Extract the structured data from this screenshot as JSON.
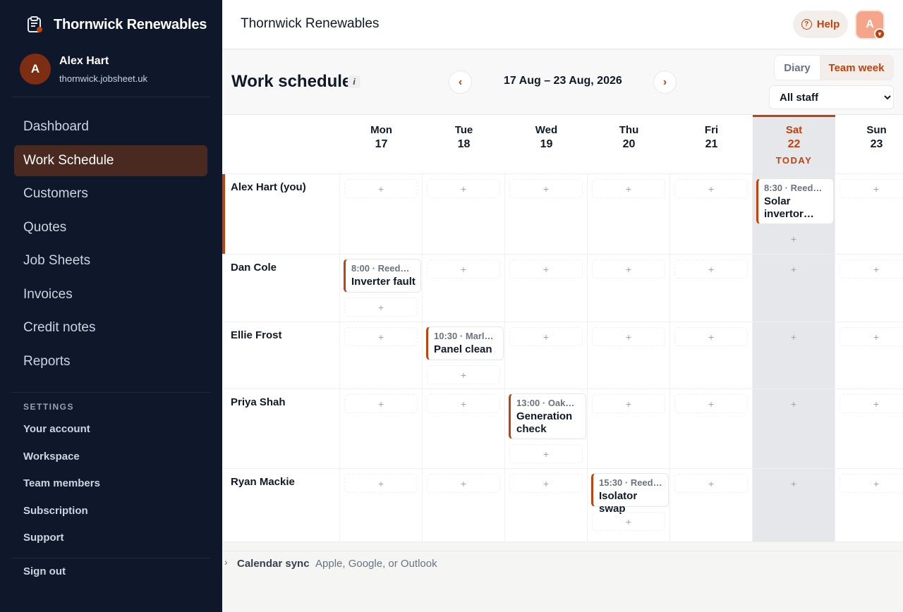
{
  "brand": {
    "name": "Thornwick Renewables",
    "icon": "clipboard-icon"
  },
  "user": {
    "initial": "A",
    "name": "Alex Hart",
    "domain": "thornwick.jobsheet.uk"
  },
  "nav": [
    {
      "label": "Dashboard"
    },
    {
      "label": "Work Schedule",
      "active": true
    },
    {
      "label": "Customers"
    },
    {
      "label": "Quotes"
    },
    {
      "label": "Job Sheets"
    },
    {
      "label": "Invoices"
    },
    {
      "label": "Credit notes"
    },
    {
      "label": "Reports"
    }
  ],
  "settings": {
    "heading": "SETTINGS",
    "items": [
      {
        "label": "Your account"
      },
      {
        "label": "Workspace"
      },
      {
        "label": "Team members"
      },
      {
        "label": "Subscription"
      },
      {
        "label": "Support"
      }
    ],
    "signout": "Sign out"
  },
  "topbar": {
    "title": "Thornwick Renewables",
    "help": "Help",
    "avatar": "A"
  },
  "schedule": {
    "title": "Work schedule",
    "info": "i",
    "prev": "‹",
    "next": "›",
    "range": "17 Aug – 23 Aug, 2026",
    "views": {
      "diary": "Diary",
      "team_week": "Team week",
      "active": "team_week"
    },
    "staff_filter": {
      "selected": "All staff"
    },
    "today_label": "TODAY",
    "add_symbol": "+",
    "days": [
      {
        "name": "Mon",
        "date": "17"
      },
      {
        "name": "Tue",
        "date": "18"
      },
      {
        "name": "Wed",
        "date": "19"
      },
      {
        "name": "Thu",
        "date": "20"
      },
      {
        "name": "Fri",
        "date": "21"
      },
      {
        "name": "Sat",
        "date": "22",
        "today": true
      },
      {
        "name": "Sun",
        "date": "23"
      }
    ],
    "staff": [
      {
        "name": "Alex Hart (you)",
        "current_user": true,
        "jobs": [
          {
            "day": 5,
            "time": "8:30",
            "customer": "Reed…",
            "title": "Solar invertor…"
          }
        ]
      },
      {
        "name": "Dan Cole",
        "jobs": [
          {
            "day": 0,
            "time": "8:00",
            "customer": "Reed…",
            "title": "Inverter fault"
          }
        ]
      },
      {
        "name": "Ellie Frost",
        "jobs": [
          {
            "day": 1,
            "time": "10:30",
            "customer": "Marl…",
            "title": "Panel clean"
          }
        ]
      },
      {
        "name": "Priya Shah",
        "jobs": [
          {
            "day": 2,
            "time": "13:00",
            "customer": "Oak…",
            "title": "Generation check"
          }
        ]
      },
      {
        "name": "Ryan Mackie",
        "jobs": [
          {
            "day": 3,
            "time": "15:30",
            "customer": "Reed…",
            "title": "Isolator swap"
          }
        ]
      }
    ]
  },
  "footer": {
    "label": "Calendar sync",
    "description": "Apple, Google, or Outlook"
  },
  "colors": {
    "accent": "#c2410c",
    "sidebar": "#0f172a",
    "today_column": "#e5e7eb"
  }
}
